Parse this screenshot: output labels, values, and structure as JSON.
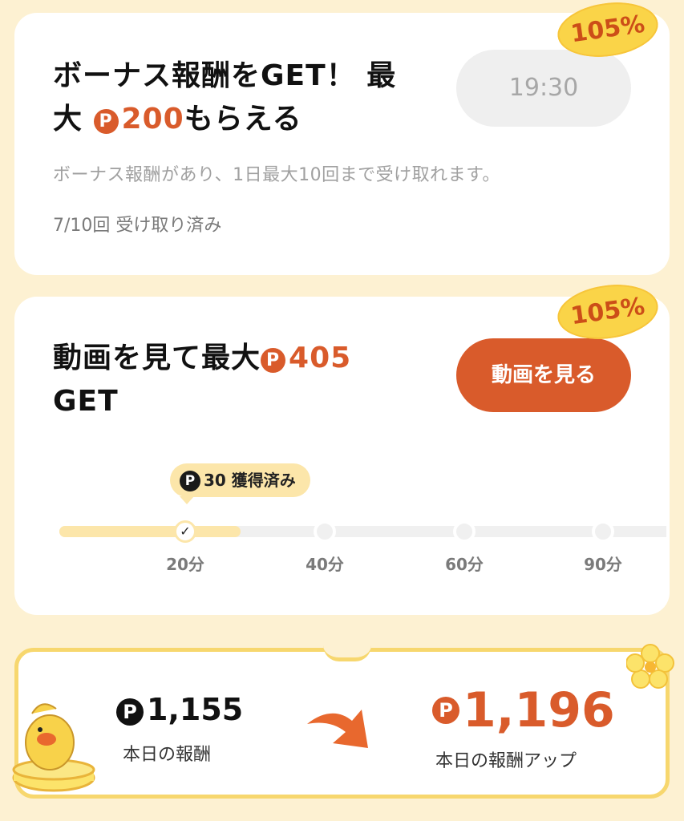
{
  "bonus_card": {
    "badge": "105%",
    "title_line1": "ボーナス報酬をGET！ 最",
    "title_line2_prefix": "大 ",
    "title_amount": "200",
    "title_suffix": "もらえる",
    "timer": "19:30",
    "description": "ボーナス報酬があり、1日最大10回まで受け取れます。",
    "count": "7/10回 受け取り済み",
    "point_symbol": "P"
  },
  "video_card": {
    "badge": "105%",
    "title_prefix": "動画を見て最大",
    "title_amount": "405",
    "title_line2": "GET",
    "button_label": "動画を見る",
    "tooltip": "30 獲得済み",
    "progress_fraction": 0.3,
    "milestones": [
      {
        "label": "20分",
        "done": true
      },
      {
        "label": "40分",
        "done": false
      },
      {
        "label": "60分",
        "done": false
      },
      {
        "label": "90分",
        "done": false
      }
    ],
    "check_mark": "✓"
  },
  "summary": {
    "today_value": "1,155",
    "today_label": "本日の報酬",
    "up_value": "1,196",
    "up_label": "本日の報酬アップ"
  },
  "colors": {
    "accent": "#D95B2B",
    "background": "#FDF1D2",
    "badge": "#FAD448",
    "progress_fill": "#FCE6AA"
  },
  "icons": [
    "point-coin-icon",
    "arrow-up-right-icon",
    "flower-icon",
    "mascot-chick-icon",
    "check-icon"
  ]
}
